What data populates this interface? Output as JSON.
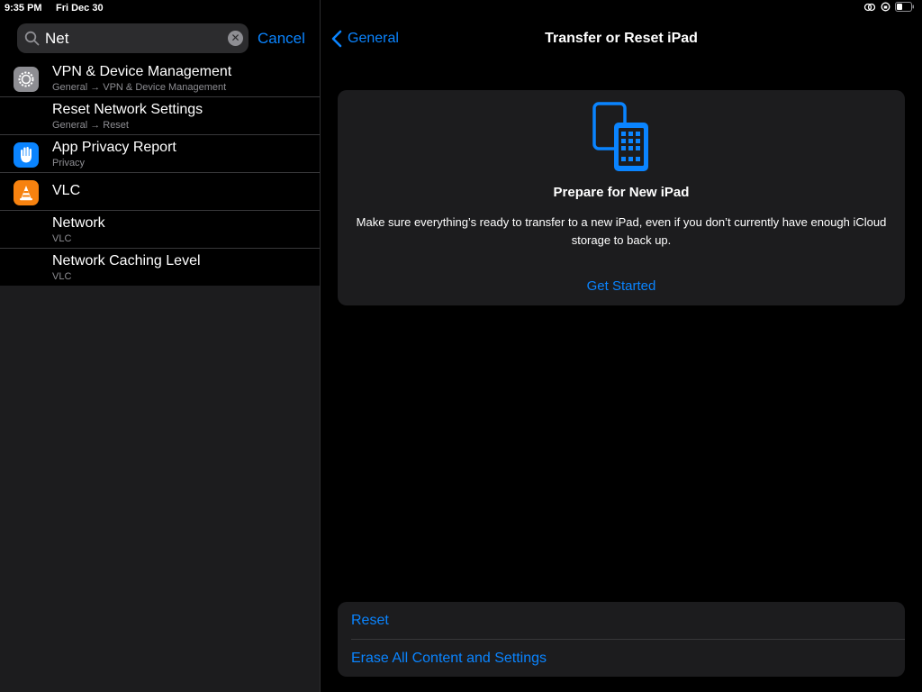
{
  "status": {
    "time": "9:35 PM",
    "date": "Fri Dec 30"
  },
  "search": {
    "value": "Net",
    "cancel_label": "Cancel"
  },
  "results": [
    {
      "title": "VPN & Device Management",
      "subtitle": "General → VPN & Device Management",
      "icon": "gear-icon"
    },
    {
      "title": "Reset Network Settings",
      "subtitle": "General → Reset",
      "icon": ""
    },
    {
      "title": "App Privacy Report",
      "subtitle": "Privacy",
      "icon": "hand-icon"
    },
    {
      "title": "VLC",
      "subtitle": "",
      "icon": "vlc-cone-icon"
    },
    {
      "title": "Network",
      "subtitle": "VLC",
      "icon": ""
    },
    {
      "title": "Network Caching Level",
      "subtitle": "VLC",
      "icon": ""
    }
  ],
  "nav": {
    "back_label": "General",
    "title": "Transfer or Reset iPad"
  },
  "prepare": {
    "title": "Prepare for New iPad",
    "description": "Make sure everything’s ready to transfer to a new iPad, even if you don’t currently have enough iCloud storage to back up.",
    "action_label": "Get Started"
  },
  "actions": {
    "reset_label": "Reset",
    "erase_label": "Erase All Content and Settings"
  },
  "colors": {
    "accent": "#0a84ff",
    "background": "#000000",
    "card": "#1c1c1e",
    "vlc": "#f7820f"
  }
}
